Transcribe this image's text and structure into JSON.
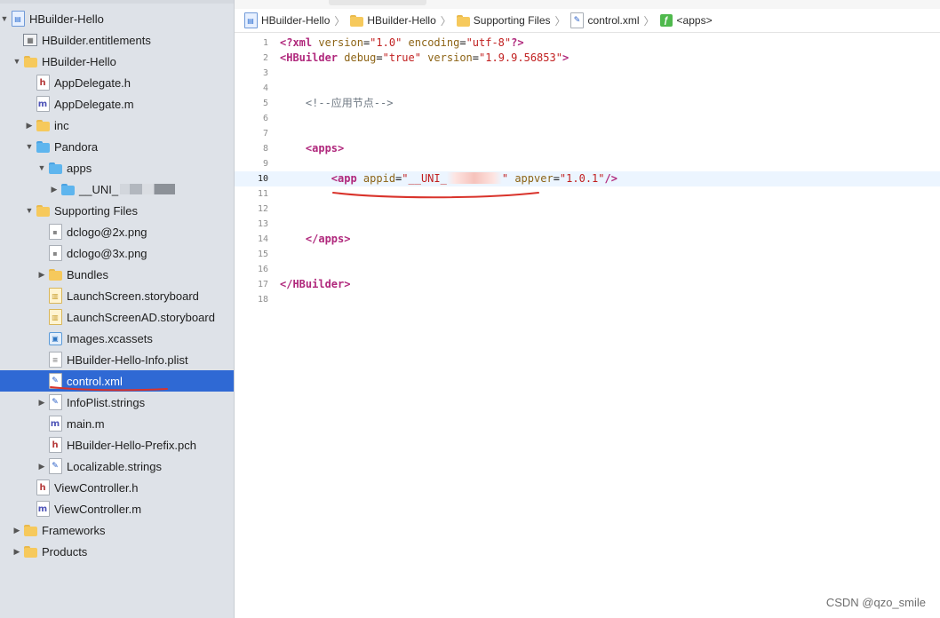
{
  "navigator": {
    "items": [
      {
        "label": "HBuilder-Hello",
        "icon": "project-icon",
        "indent": 0,
        "arrow": "down",
        "name": "project-root"
      },
      {
        "label": "HBuilder.entitlements",
        "icon": "entitlements-icon",
        "indent": 1,
        "arrow": "",
        "name": "file-entitlements"
      },
      {
        "label": "HBuilder-Hello",
        "icon": "folder-icon",
        "indent": 1,
        "arrow": "down",
        "name": "group-hbuilder-hello"
      },
      {
        "label": "AppDelegate.h",
        "icon": "header-file-icon",
        "indent": 2,
        "arrow": "",
        "name": "file-appdelegate-h"
      },
      {
        "label": "AppDelegate.m",
        "icon": "objc-file-icon",
        "indent": 2,
        "arrow": "",
        "name": "file-appdelegate-m"
      },
      {
        "label": "inc",
        "icon": "folder-icon",
        "indent": 2,
        "arrow": "right",
        "name": "group-inc"
      },
      {
        "label": "Pandora",
        "icon": "blue-folder-icon",
        "indent": 2,
        "arrow": "down",
        "name": "group-pandora"
      },
      {
        "label": "apps",
        "icon": "blue-folder-icon",
        "indent": 3,
        "arrow": "down",
        "name": "group-apps"
      },
      {
        "label": "__UNI_",
        "icon": "blue-folder-icon",
        "indent": 4,
        "arrow": "right",
        "name": "group-uni-app",
        "redacted": true
      },
      {
        "label": "Supporting Files",
        "icon": "folder-icon",
        "indent": 2,
        "arrow": "down",
        "name": "group-supporting-files"
      },
      {
        "label": "dclogo@2x.png",
        "icon": "image-file-icon",
        "indent": 3,
        "arrow": "",
        "name": "file-dclogo-2x"
      },
      {
        "label": "dclogo@3x.png",
        "icon": "image-file-icon",
        "indent": 3,
        "arrow": "",
        "name": "file-dclogo-3x"
      },
      {
        "label": "Bundles",
        "icon": "folder-icon",
        "indent": 3,
        "arrow": "right",
        "name": "group-bundles"
      },
      {
        "label": "LaunchScreen.storyboard",
        "icon": "storyboard-file-icon",
        "indent": 3,
        "arrow": "",
        "name": "file-launchscreen"
      },
      {
        "label": "LaunchScreenAD.storyboard",
        "icon": "storyboard-file-icon",
        "indent": 3,
        "arrow": "",
        "name": "file-launchscreen-ad"
      },
      {
        "label": "Images.xcassets",
        "icon": "asset-catalog-icon",
        "indent": 3,
        "arrow": "",
        "name": "file-images-xcassets"
      },
      {
        "label": "HBuilder-Hello-Info.plist",
        "icon": "plist-file-icon",
        "indent": 3,
        "arrow": "",
        "name": "file-info-plist"
      },
      {
        "label": "control.xml",
        "icon": "xml-file-icon",
        "indent": 3,
        "arrow": "",
        "name": "file-control-xml",
        "selected": true
      },
      {
        "label": "InfoPlist.strings",
        "icon": "strings-file-icon",
        "indent": 3,
        "arrow": "right",
        "name": "file-infoplist-strings"
      },
      {
        "label": "main.m",
        "icon": "objc-file-icon",
        "indent": 3,
        "arrow": "",
        "name": "file-main-m"
      },
      {
        "label": "HBuilder-Hello-Prefix.pch",
        "icon": "header-file-icon",
        "indent": 3,
        "arrow": "",
        "name": "file-prefix-pch"
      },
      {
        "label": "Localizable.strings",
        "icon": "strings-file-icon",
        "indent": 3,
        "arrow": "right",
        "name": "file-localizable-strings"
      },
      {
        "label": "ViewController.h",
        "icon": "header-file-icon",
        "indent": 2,
        "arrow": "",
        "name": "file-viewcontroller-h"
      },
      {
        "label": "ViewController.m",
        "icon": "objc-file-icon",
        "indent": 2,
        "arrow": "",
        "name": "file-viewcontroller-m"
      },
      {
        "label": "Frameworks",
        "icon": "folder-icon",
        "indent": 1,
        "arrow": "right",
        "name": "group-frameworks"
      },
      {
        "label": "Products",
        "icon": "folder-icon",
        "indent": 1,
        "arrow": "right",
        "name": "group-products"
      }
    ]
  },
  "breadcrumb": [
    {
      "label": "HBuilder-Hello",
      "icon": "project-icon"
    },
    {
      "label": "HBuilder-Hello",
      "icon": "folder-icon"
    },
    {
      "label": "Supporting Files",
      "icon": "folder-icon"
    },
    {
      "label": "control.xml",
      "icon": "xml-file-icon"
    },
    {
      "label": "<apps>",
      "icon": "symbol-icon"
    }
  ],
  "editor": {
    "current_line": 10,
    "lines": [
      {
        "n": "1",
        "parts": [
          [
            "tag",
            "<?xml "
          ],
          [
            "attr",
            "version"
          ],
          [
            "plain",
            "="
          ],
          [
            "str",
            "\"1.0\""
          ],
          [
            "plain",
            " "
          ],
          [
            "attr",
            "encoding"
          ],
          [
            "plain",
            "="
          ],
          [
            "str",
            "\"utf-8\""
          ],
          [
            "tag",
            "?>"
          ]
        ]
      },
      {
        "n": "2",
        "parts": [
          [
            "tag",
            "<HBuilder "
          ],
          [
            "attr",
            "debug"
          ],
          [
            "plain",
            "="
          ],
          [
            "str",
            "\"true\""
          ],
          [
            "plain",
            " "
          ],
          [
            "attr",
            "version"
          ],
          [
            "plain",
            "="
          ],
          [
            "str",
            "\"1.9.9.56853\""
          ],
          [
            "tag",
            ">"
          ]
        ]
      },
      {
        "n": "3",
        "parts": []
      },
      {
        "n": "4",
        "parts": []
      },
      {
        "n": "5",
        "parts": [
          [
            "plain",
            "    "
          ],
          [
            "comment",
            "<!--应用节点-->"
          ]
        ]
      },
      {
        "n": "6",
        "parts": []
      },
      {
        "n": "7",
        "parts": []
      },
      {
        "n": "8",
        "parts": [
          [
            "plain",
            "    "
          ],
          [
            "tag",
            "<apps>"
          ]
        ]
      },
      {
        "n": "9",
        "parts": []
      },
      {
        "n": "10",
        "parts": [
          [
            "plain",
            "        "
          ],
          [
            "tag",
            "<app "
          ],
          [
            "attr",
            "appid"
          ],
          [
            "plain",
            "="
          ],
          [
            "str",
            "\"__UNI_"
          ],
          [
            "blur",
            ""
          ],
          [
            "str",
            "\""
          ],
          [
            "plain",
            " "
          ],
          [
            "attr",
            "appver"
          ],
          [
            "plain",
            "="
          ],
          [
            "str",
            "\"1.0.1\""
          ],
          [
            "tag",
            "/>"
          ]
        ]
      },
      {
        "n": "11",
        "parts": []
      },
      {
        "n": "12",
        "parts": []
      },
      {
        "n": "13",
        "parts": []
      },
      {
        "n": "14",
        "parts": [
          [
            "plain",
            "    "
          ],
          [
            "tag",
            "</apps>"
          ]
        ]
      },
      {
        "n": "15",
        "parts": []
      },
      {
        "n": "16",
        "parts": []
      },
      {
        "n": "17",
        "parts": [
          [
            "tag",
            "</HBuilder>"
          ]
        ]
      },
      {
        "n": "18",
        "parts": []
      }
    ]
  },
  "watermark": "CSDN @qzo_smile",
  "colors": {
    "selection": "#2f69d4",
    "annotation": "#d9332b",
    "xml_tag": "#b0287c",
    "xml_attr": "#8d6416",
    "xml_string": "#c11f1f"
  }
}
